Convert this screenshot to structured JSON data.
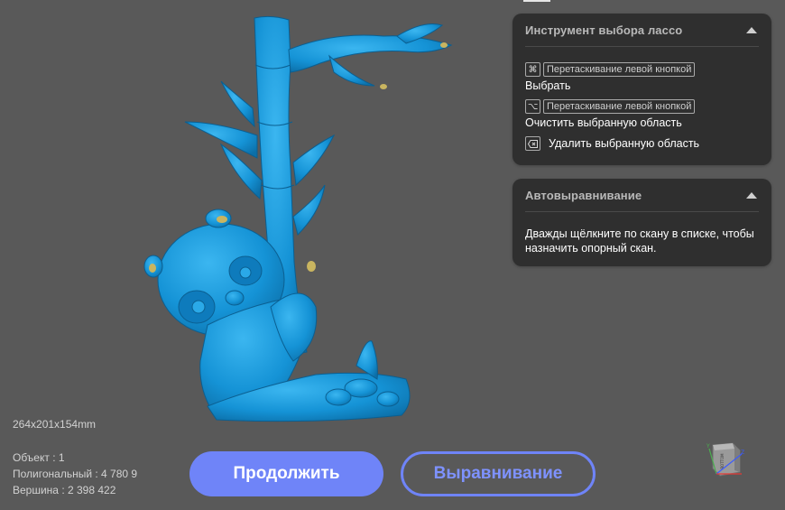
{
  "lasso_panel": {
    "title": "Инструмент выбора лассо",
    "select_key": "⌘",
    "select_hint": "Перетаскивание левой кнопкой",
    "select_label": "Выбрать",
    "clear_key": "⌥",
    "clear_hint": "Перетаскивание левой кнопкой",
    "clear_label": "Очистить выбранную область",
    "delete_label": "Удалить выбранную область"
  },
  "align_panel": {
    "title": "Автовыравнивание",
    "text": "Дважды щёлкните по скану в списке, чтобы назначить опорный скан."
  },
  "stats": {
    "dimensions": "264x201x154mm",
    "objects": "Объект : 1",
    "polygons": "Полигональный : 4 780 9",
    "vertices": "Вершина : 2 398 422"
  },
  "buttons": {
    "continue_label": "Продолжить",
    "align_label": "Выравнивание"
  },
  "view_cube": {
    "face_label": "BOTTOM",
    "axis_y": "Y",
    "axis_z": "Z"
  },
  "colors": {
    "background": "#595959",
    "model": "#1593d6",
    "accent": "#6f84f8",
    "panel": "#2f2f2f"
  }
}
